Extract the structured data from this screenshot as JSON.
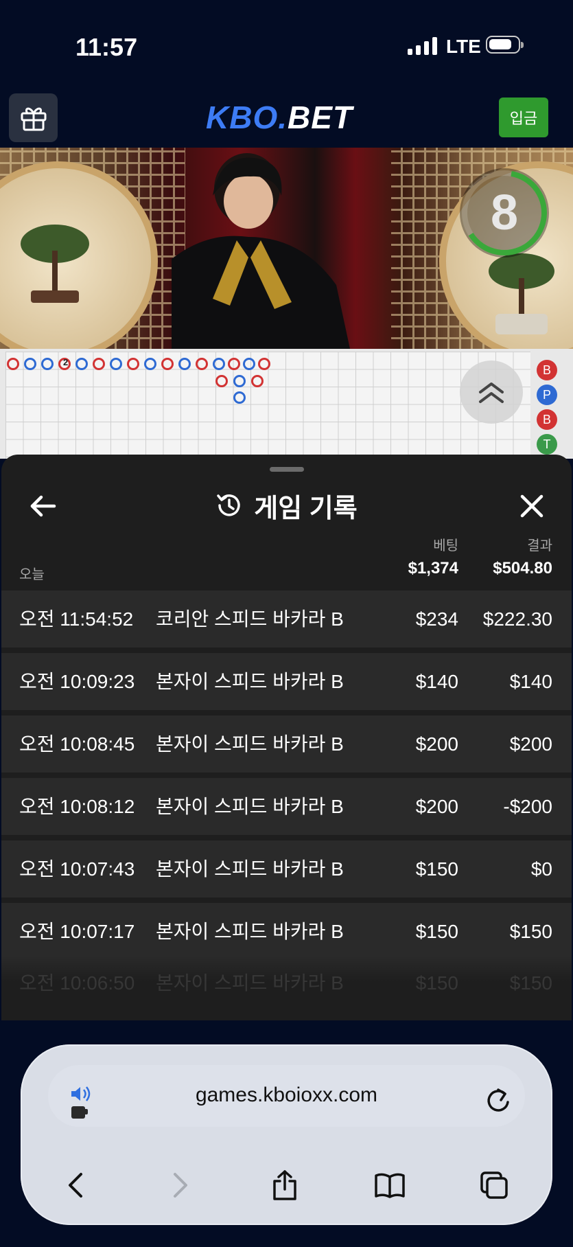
{
  "status_bar": {
    "time": "11:57",
    "network": "LTE"
  },
  "header": {
    "logo_left": "KBO.",
    "logo_right": "BET",
    "deposit_label": "입금"
  },
  "video": {
    "countdown": "8",
    "roadmap_marker": "2"
  },
  "side_beads": [
    "B",
    "P",
    "B",
    "T"
  ],
  "history": {
    "title": "게임 기록",
    "col_bet": "베팅",
    "col_result": "결과",
    "today_label": "오늘",
    "total_bet": "$1,374",
    "total_result": "$504.80",
    "rows": [
      {
        "time": "오전 11:54:52",
        "game": "코리안 스피드 바카라 B",
        "bet": "$234",
        "result": "$222.30"
      },
      {
        "time": "오전 10:09:23",
        "game": "본자이 스피드 바카라 B",
        "bet": "$140",
        "result": "$140"
      },
      {
        "time": "오전 10:08:45",
        "game": "본자이 스피드 바카라 B",
        "bet": "$200",
        "result": "$200"
      },
      {
        "time": "오전 10:08:12",
        "game": "본자이 스피드 바카라 B",
        "bet": "$200",
        "result": "-$200"
      },
      {
        "time": "오전 10:07:43",
        "game": "본자이 스피드 바카라 B",
        "bet": "$150",
        "result": "$0"
      },
      {
        "time": "오전 10:07:17",
        "game": "본자이 스피드 바카라 B",
        "bet": "$150",
        "result": "$150"
      }
    ],
    "partial_row": {
      "time": "오전 10:06:50",
      "game": "본자이 스피드 바카라 B",
      "bet": "$150",
      "result": "$150"
    }
  },
  "browser": {
    "url": "games.kboioxx.com"
  },
  "colors": {
    "accent_blue": "#3d7cf5",
    "deposit_green": "#2f9a2e",
    "banker_red": "#d23333",
    "player_blue": "#2e6ad3",
    "tie_green": "#3a9a4a"
  }
}
